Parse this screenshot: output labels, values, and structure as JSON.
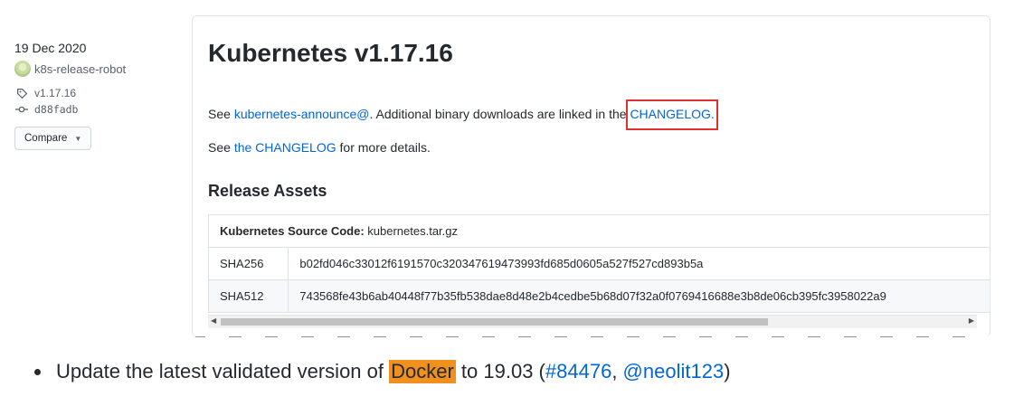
{
  "meta": {
    "date": "19 Dec 2020",
    "author": "k8s-release-robot",
    "tag": "v1.17.16",
    "commit": "d88fadb",
    "compare_label": "Compare"
  },
  "release": {
    "title": "Kubernetes v1.17.16",
    "p1_prefix": "See ",
    "p1_link": "kubernetes-announce@",
    "p1_mid": ". Additional binary downloads are linked in the ",
    "p1_link2": "CHANGELOG.",
    "p2_prefix": "See ",
    "p2_link": "the CHANGELOG",
    "p2_suffix": " for more details."
  },
  "assets": {
    "title": "Release Assets",
    "source_label": "Kubernetes Source Code:",
    "source_file": " kubernetes.tar.gz",
    "rows": [
      {
        "algo": "SHA256",
        "hash": "b02fd046c33012f6191570c320347619473993fd685d0605a527f527cd893b5a"
      },
      {
        "algo": "SHA512",
        "hash": "743568fe43b6ab40448f77b35fb538dae8d48e2b4cedbe5b68d07f32a0f0769416688e3b8de06cb395fc3958022a9"
      }
    ]
  },
  "bullet": {
    "prefix": "Update the latest validated version of ",
    "highlight": "Docker",
    "mid": " to 19.03 (",
    "link1": "#84476",
    "sep": ", ",
    "link2": "@neolit123",
    "suffix": ")"
  },
  "colors": {
    "link": "#0366d6",
    "highlight_box": "#e03131",
    "docker_highlight": "#f0901f"
  }
}
